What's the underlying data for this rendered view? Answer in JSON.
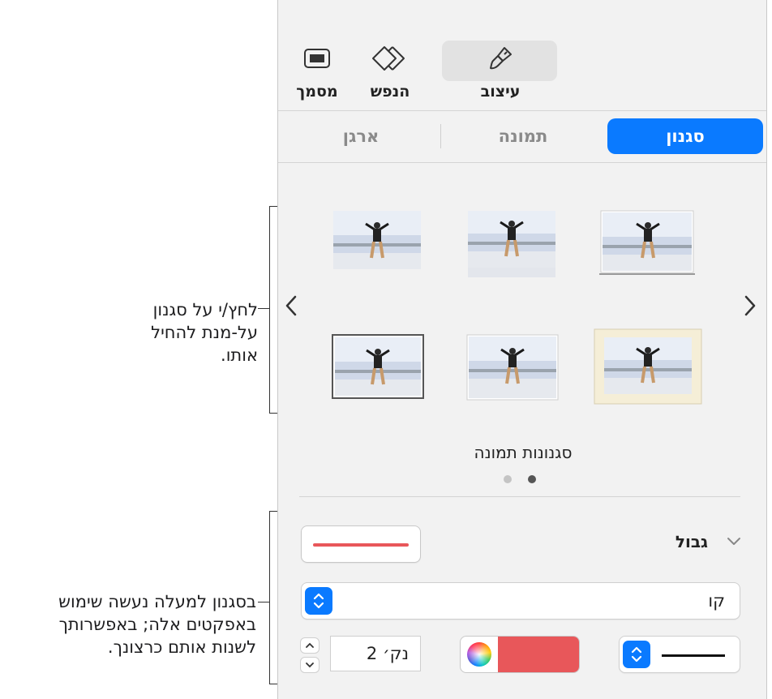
{
  "toolbar": {
    "format_label": "עיצוב",
    "shape_label": "הנפש",
    "document_label": "מסמך"
  },
  "tabs": [
    {
      "label": "סגנון",
      "active": true
    },
    {
      "label": "תמונה",
      "active": false
    },
    {
      "label": "ארגן",
      "active": false
    }
  ],
  "styles": {
    "title": "סגנונות תמונה",
    "page_count": 2,
    "current_page": 1
  },
  "border": {
    "section_title": "גבול",
    "line_type_value": "קו",
    "stroke_size_value": "2 נק׳",
    "color": "#e8575a"
  },
  "callouts": {
    "top": "לחץ/י על סגנון על-מנת להחיל אותו.",
    "bottom": "בסגנון למעלה נעשה שימוש באפקטים אלה; באפשרותך לשנות אותם כרצונך."
  },
  "colors": {
    "accent": "#0a7aff",
    "stroke_red": "#e8575a"
  },
  "icons": {
    "format": "paintbrush-icon",
    "shape": "diamond-icon",
    "document": "document-icon",
    "prev": "chevron-left-icon",
    "next": "chevron-right-icon",
    "disclosure": "chevron-down-icon",
    "popup": "updown-chevron-icon"
  }
}
